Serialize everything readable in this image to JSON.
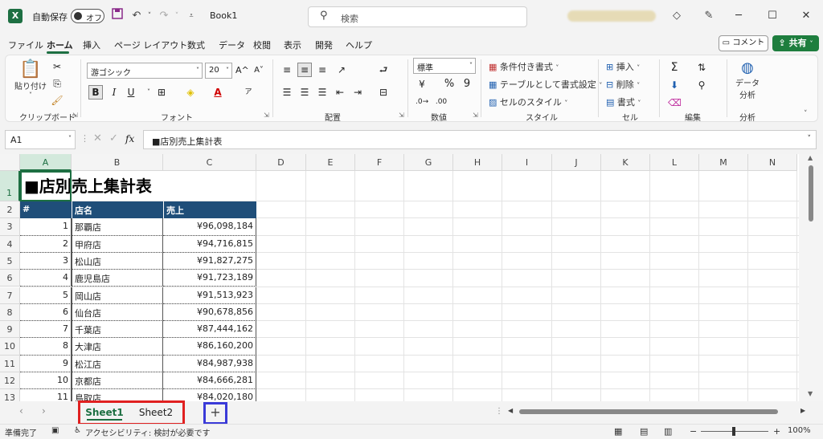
{
  "titlebar": {
    "app_icon": "excel-icon",
    "autosave_label": "自動保存",
    "autosave_state": "オフ",
    "save_icon": "save-icon",
    "undo_icon": "undo-icon",
    "redo_icon": "redo-icon",
    "customize_icon": "customize-qat-icon",
    "document_title": "Book1",
    "search_placeholder": "検索",
    "minimize": "─",
    "maximize": "☐",
    "close": "✕"
  },
  "ribbon_tabs": [
    {
      "label": "ファイル"
    },
    {
      "label": "ホーム"
    },
    {
      "label": "挿入"
    },
    {
      "label": "ページ レイアウト"
    },
    {
      "label": "数式"
    },
    {
      "label": "データ"
    },
    {
      "label": "校閲"
    },
    {
      "label": "表示"
    },
    {
      "label": "開発"
    },
    {
      "label": "ヘルプ"
    }
  ],
  "actions": {
    "comment": "コメント",
    "share": "共有"
  },
  "ribbon": {
    "clipboard": {
      "paste": "貼り付け",
      "label": "クリップボード"
    },
    "font": {
      "name": "游ゴシック",
      "size": "20",
      "label": "フォント",
      "bold": "B",
      "italic": "I",
      "underline": "U",
      "grow": "A^",
      "shrink": "A˅",
      "font_color": "A"
    },
    "alignment": {
      "label": "配置"
    },
    "number": {
      "format": "標準",
      "label": "数値",
      "percent": "%",
      "comma": "9"
    },
    "styles": {
      "conditional": "条件付き書式",
      "table": "テーブルとして書式設定",
      "cell_styles": "セルのスタイル",
      "label": "スタイル"
    },
    "cells": {
      "insert": "挿入",
      "delete": "削除",
      "format": "書式",
      "label": "セル"
    },
    "editing": {
      "label": "編集"
    },
    "analysis": {
      "data_analysis_line1": "データ",
      "data_analysis_line2": "分析",
      "label": "分析"
    }
  },
  "formula_bar": {
    "name_box": "A1",
    "fx": "fx",
    "content": "■店別売上集計表"
  },
  "grid": {
    "columns": [
      "A",
      "B",
      "C",
      "D",
      "E",
      "F",
      "G",
      "H",
      "I",
      "J",
      "K",
      "L",
      "M",
      "N"
    ],
    "rows": [
      "1",
      "2",
      "3",
      "4",
      "5",
      "6",
      "7",
      "8",
      "9",
      "10",
      "11",
      "12",
      "13"
    ],
    "title": "■店別売上集計表",
    "headers": [
      "#",
      "店名",
      "売上"
    ],
    "data": [
      {
        "no": "1",
        "store": "那覇店",
        "sales": "¥96,098,184"
      },
      {
        "no": "2",
        "store": "甲府店",
        "sales": "¥94,716,815"
      },
      {
        "no": "3",
        "store": "松山店",
        "sales": "¥91,827,275"
      },
      {
        "no": "4",
        "store": "鹿児島店",
        "sales": "¥91,723,189"
      },
      {
        "no": "5",
        "store": "岡山店",
        "sales": "¥91,513,923"
      },
      {
        "no": "6",
        "store": "仙台店",
        "sales": "¥90,678,856"
      },
      {
        "no": "7",
        "store": "千葉店",
        "sales": "¥87,444,162"
      },
      {
        "no": "8",
        "store": "大津店",
        "sales": "¥86,160,200"
      },
      {
        "no": "9",
        "store": "松江店",
        "sales": "¥84,987,938"
      },
      {
        "no": "10",
        "store": "京都店",
        "sales": "¥84,666,281"
      },
      {
        "no": "11",
        "store": "鳥取店",
        "sales": "¥84,020,180"
      }
    ]
  },
  "sheets": [
    {
      "label": "Sheet1",
      "active": true
    },
    {
      "label": "Sheet2",
      "active": false
    }
  ],
  "add_sheet": "+",
  "status": {
    "ready": "準備完了",
    "accessibility": "アクセシビリティ: 検討が必要です",
    "zoom": "100%",
    "zoom_minus": "−",
    "zoom_plus": "+"
  },
  "colors": {
    "accent": "#1d6f42",
    "header_fill": "#1f4e79",
    "highlight_red": "#e02020",
    "highlight_blue": "#3a3ad8"
  }
}
